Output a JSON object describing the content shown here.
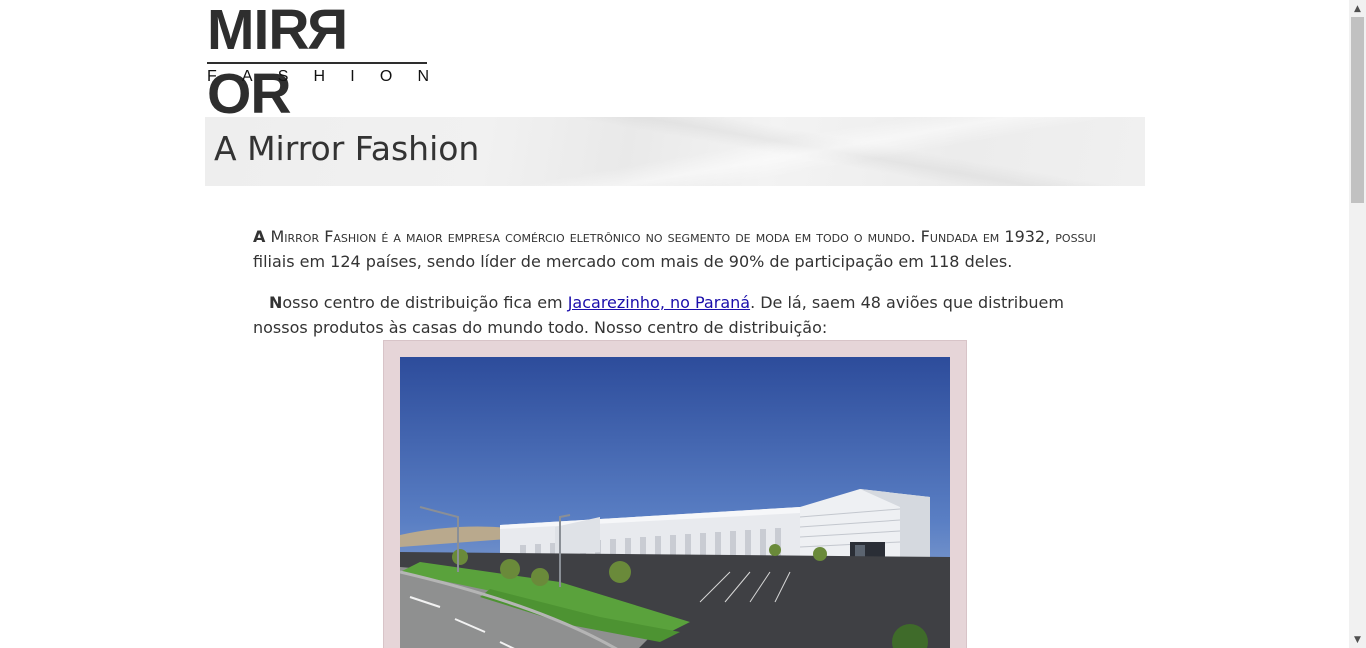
{
  "logo": {
    "word_part1": "MIR",
    "word_reversed": "R",
    "word_part2": "OR",
    "subtitle_letters": [
      "F",
      "A",
      "S",
      "H",
      "I",
      "O",
      "N"
    ]
  },
  "title": "A Mirror Fashion",
  "intro": {
    "first_letter": "A",
    "brand_rest": " Mirror Fashion",
    "small_caps_text": " é a maior empresa comércio eletrônico no segmento de moda em todo o mundo. Fundada em 1932, possui",
    "rest": " filiais em 124 países, sendo líder de mercado com mais de 90% de participação em 118 deles."
  },
  "distribution": {
    "first_letter": "N",
    "text_before": "osso centro de distribuição fica em ",
    "link": "Jacarezinho, no Paraná",
    "text_after": ". De lá, saem 48 aviões que distribuem nossos produtos às casas do mundo todo. Nosso centro de distribuição:"
  },
  "figure": {
    "image_desc": "distribution-center-photo",
    "border_color": "#e6d5d8"
  },
  "colors": {
    "text": "#333333",
    "link": "#1a0dab",
    "title_band": "#eeeeee"
  },
  "icons": {
    "scroll_up": "▲",
    "scroll_down": "▼"
  }
}
